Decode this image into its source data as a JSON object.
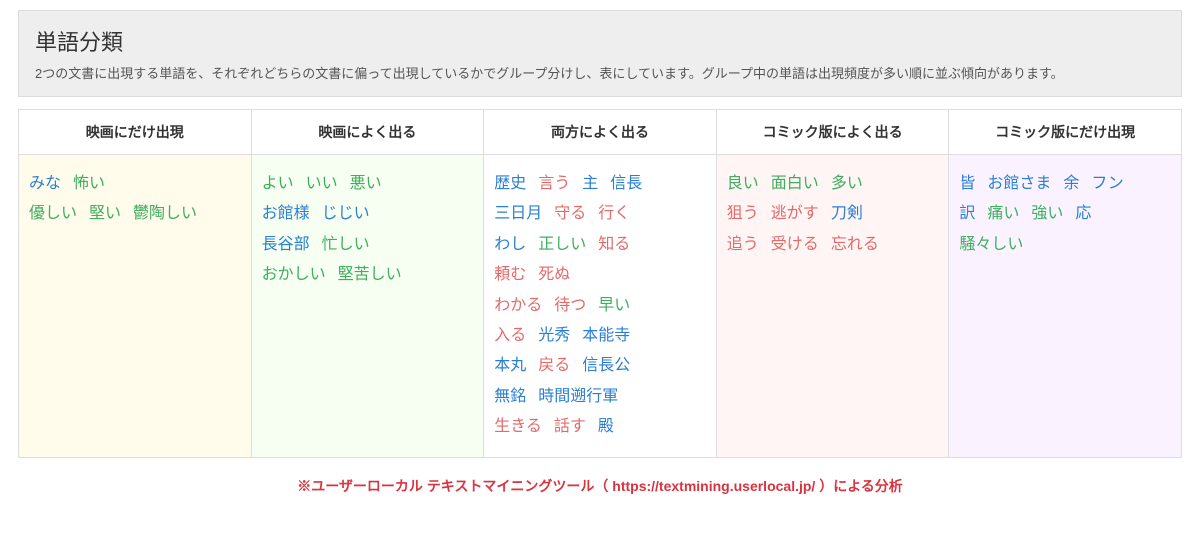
{
  "header": {
    "title": "単語分類",
    "description": "2つの文書に出現する単語を、それぞれどちらの文書に偏って出現しているかでグループ分けし、表にしています。グループ中の単語は出現頻度が多い順に並ぶ傾向があります。"
  },
  "columns": [
    {
      "key": "only_movie",
      "label": "映画にだけ出現"
    },
    {
      "key": "often_movie",
      "label": "映画によく出る"
    },
    {
      "key": "both",
      "label": "両方によく出る"
    },
    {
      "key": "often_comic",
      "label": "コミック版によく出る"
    },
    {
      "key": "only_comic",
      "label": "コミック版にだけ出現"
    }
  ],
  "words": {
    "only_movie": [
      {
        "t": "みな",
        "c": "blue"
      },
      {
        "t": "怖い",
        "c": "green"
      },
      {
        "br": true
      },
      {
        "t": "優しい",
        "c": "green"
      },
      {
        "t": "堅い",
        "c": "green"
      },
      {
        "t": "鬱陶しい",
        "c": "green"
      }
    ],
    "often_movie": [
      {
        "t": "よい",
        "c": "green"
      },
      {
        "t": "いい",
        "c": "green"
      },
      {
        "t": "悪い",
        "c": "green"
      },
      {
        "br": true
      },
      {
        "t": "お館様",
        "c": "blue"
      },
      {
        "t": "じじい",
        "c": "blue"
      },
      {
        "br": true
      },
      {
        "t": "長谷部",
        "c": "blue"
      },
      {
        "t": "忙しい",
        "c": "green"
      },
      {
        "br": true
      },
      {
        "t": "おかしい",
        "c": "green"
      },
      {
        "t": "堅苦しい",
        "c": "green"
      }
    ],
    "both": [
      {
        "t": "歴史",
        "c": "blue"
      },
      {
        "t": "言う",
        "c": "red"
      },
      {
        "t": "主",
        "c": "blue"
      },
      {
        "t": "信長",
        "c": "blue"
      },
      {
        "br": true
      },
      {
        "t": "三日月",
        "c": "blue"
      },
      {
        "t": "守る",
        "c": "red"
      },
      {
        "t": "行く",
        "c": "red"
      },
      {
        "br": true
      },
      {
        "t": "わし",
        "c": "blue"
      },
      {
        "t": "正しい",
        "c": "green"
      },
      {
        "t": "知る",
        "c": "red"
      },
      {
        "br": true
      },
      {
        "t": "頼む",
        "c": "red"
      },
      {
        "t": "死ぬ",
        "c": "red"
      },
      {
        "br": true
      },
      {
        "t": "わかる",
        "c": "red"
      },
      {
        "t": "待つ",
        "c": "red"
      },
      {
        "t": "早い",
        "c": "green"
      },
      {
        "br": true
      },
      {
        "t": "入る",
        "c": "red"
      },
      {
        "t": "光秀",
        "c": "blue"
      },
      {
        "t": "本能寺",
        "c": "blue"
      },
      {
        "br": true
      },
      {
        "t": "本丸",
        "c": "blue"
      },
      {
        "t": "戻る",
        "c": "red"
      },
      {
        "t": "信長公",
        "c": "blue"
      },
      {
        "br": true
      },
      {
        "t": "無銘",
        "c": "blue"
      },
      {
        "t": "時間遡行軍",
        "c": "blue"
      },
      {
        "br": true
      },
      {
        "t": "生きる",
        "c": "red"
      },
      {
        "t": "話す",
        "c": "red"
      },
      {
        "t": "殿",
        "c": "blue"
      }
    ],
    "often_comic": [
      {
        "t": "良い",
        "c": "green"
      },
      {
        "t": "面白い",
        "c": "green"
      },
      {
        "t": "多い",
        "c": "green"
      },
      {
        "br": true
      },
      {
        "t": "狙う",
        "c": "red"
      },
      {
        "t": "逃がす",
        "c": "red"
      },
      {
        "t": "刀剣",
        "c": "blue"
      },
      {
        "br": true
      },
      {
        "t": "追う",
        "c": "red"
      },
      {
        "t": "受ける",
        "c": "red"
      },
      {
        "t": "忘れる",
        "c": "red"
      }
    ],
    "only_comic": [
      {
        "t": "皆",
        "c": "blue"
      },
      {
        "t": "お館さま",
        "c": "blue"
      },
      {
        "t": "余",
        "c": "blue"
      },
      {
        "t": "フン",
        "c": "blue"
      },
      {
        "br": true
      },
      {
        "t": "訳",
        "c": "blue"
      },
      {
        "t": "痛い",
        "c": "green"
      },
      {
        "t": "強い",
        "c": "green"
      },
      {
        "t": "応",
        "c": "blue"
      },
      {
        "br": true
      },
      {
        "t": "騒々しい",
        "c": "green"
      }
    ]
  },
  "credit": {
    "prefix": "※ユーザーローカル テキストマイニングツール（ ",
    "url": "https://textmining.userlocal.jp/",
    "suffix": " ）による分析"
  }
}
